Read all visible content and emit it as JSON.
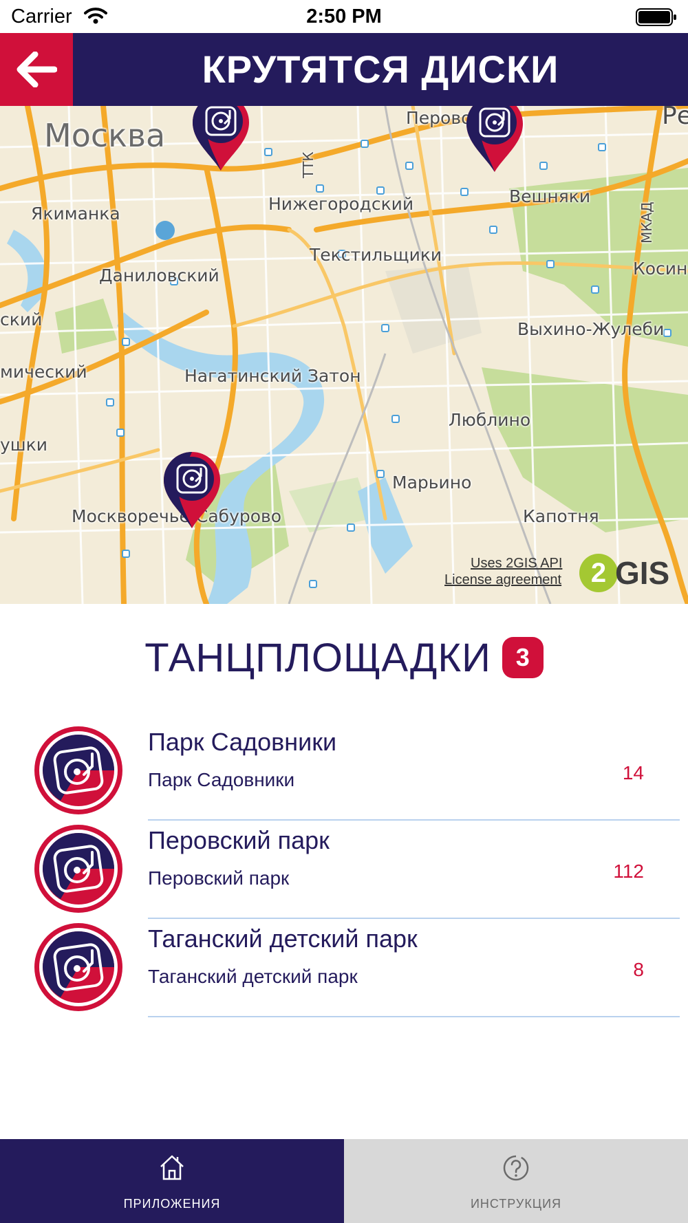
{
  "status_bar": {
    "carrier": "Carrier",
    "time": "2:50 PM"
  },
  "header": {
    "title": "КРУТЯТСЯ ДИСКИ",
    "back_icon": "arrow-left-icon"
  },
  "map": {
    "labels": {
      "moskva": "Москва",
      "perovo": "Перово",
      "re": "Ре",
      "ttk": "ТТК",
      "nizhegorodsky": "Нижегородский",
      "veshnyaki": "Вешняки",
      "mkad": "МКАД",
      "yakimanka": "Якиманка",
      "tekstilshchiki": "Текстильщики",
      "kosino": "Косин",
      "danilovsky": "Даниловский",
      "sky": "ский",
      "vykhino": "Выхино-Жулеби",
      "michesky": "мический",
      "nagatinsky": "Нагатинский Затон",
      "lyublino": "Люблино",
      "ushki": "ушки",
      "marino": "Марьино",
      "kapotnya": "Капотня",
      "moskvorechye": "Москворечье-Сабурово"
    },
    "attribution": {
      "api": "Uses 2GIS API",
      "license": "License agreement",
      "logo_digit": "2",
      "logo_text": "GIS"
    },
    "pins": [
      {
        "icon": "turntable-pin-icon"
      },
      {
        "icon": "turntable-pin-icon"
      },
      {
        "icon": "turntable-pin-icon"
      }
    ],
    "colors": {
      "road_major": "#f4a92a",
      "water": "#a9d6ee",
      "park": "#c6dd9b",
      "land": "#f3ecd9"
    }
  },
  "section": {
    "title": "ТАНЦПЛОЩАДКИ",
    "count": "3"
  },
  "venues": [
    {
      "title": "Парк Садовники",
      "subtitle": "Парк Садовники",
      "count": "14"
    },
    {
      "title": "Перовский парк",
      "subtitle": "Перовский парк",
      "count": "112"
    },
    {
      "title": "Таганский детский парк",
      "subtitle": "Таганский детский парк",
      "count": "8"
    }
  ],
  "tabs": [
    {
      "label": "ПРИЛОЖЕНИЯ",
      "icon": "home-icon",
      "active": true
    },
    {
      "label": "ИНСТРУКЦИЯ",
      "icon": "help-icon",
      "active": false
    }
  ],
  "theme": {
    "primary": "#241b5c",
    "accent": "#d0103a",
    "divider": "#b9d1ee"
  }
}
